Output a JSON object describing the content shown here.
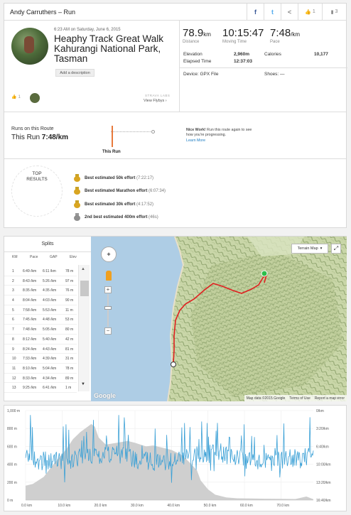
{
  "header": {
    "title": "Andy Carruthers – Run",
    "fb": "f",
    "tw": "t",
    "share": "<",
    "kudos_count": "1",
    "comments_count": "3"
  },
  "activity": {
    "date": "6:23 AM on Saturday, June 6, 2015",
    "name": "Heaphy Track Great Walk Kahurangi National Park, Tasman",
    "add_description": "Add a description",
    "kudos": "1",
    "strava_labs": "STRAVA LABS",
    "view_flybys": "View Flybys ›"
  },
  "stats": {
    "distance": {
      "value": "78.9",
      "unit": "km",
      "label": "Distance"
    },
    "moving_time": {
      "value": "10:15:47",
      "label": "Moving Time"
    },
    "pace": {
      "value": "7:48",
      "unit": "/km",
      "label": "Pace"
    },
    "elevation_label": "Elevation",
    "elevation_value": "2,960m",
    "calories_label": "Calories",
    "calories_value": "10,177",
    "elapsed_label": "Elapsed Time",
    "elapsed_value": "12:37:03",
    "device_label": "Device: GPX File",
    "shoes_label": "Shoes: —"
  },
  "route": {
    "runs_on_route": "Runs on this Route",
    "this_run_prefix": "This Run ",
    "this_run_pace": "7:48/km",
    "marker_label": "This Run",
    "nice_bold": "Nice Work!",
    "nice_text": " Run this route again to see how you're progressing.",
    "learn_more": "Learn More"
  },
  "top_results": {
    "title": "TOP RESULTS",
    "items": [
      {
        "medal": "gold",
        "text": "Best estimated 50k effort",
        "time": "(7:22:17)"
      },
      {
        "medal": "gold",
        "text": "Best estimated Marathon effort",
        "time": "(6:07:34)"
      },
      {
        "medal": "gold",
        "text": "Best estimated 30k effort",
        "time": "(4:17:52)"
      },
      {
        "medal": "silver",
        "text": "2nd best estimated 400m effort",
        "time": "(46s)"
      }
    ]
  },
  "splits": {
    "title": "Splits",
    "columns": [
      "KM",
      "Pace",
      "GAP",
      "Elev"
    ],
    "rows": [
      [
        "1",
        "6:49 /km",
        "6:11 /km",
        "78 m"
      ],
      [
        "2",
        "8:43 /km",
        "5:26 /km",
        "97 m"
      ],
      [
        "3",
        "8:35 /km",
        "4:35 /km",
        "76 m"
      ],
      [
        "4",
        "8:04 /km",
        "4:03 /km",
        "90 m"
      ],
      [
        "5",
        "7:58 /km",
        "5:53 /km",
        "11 m"
      ],
      [
        "6",
        "7:45 /km",
        "4:48 /km",
        "53 m"
      ],
      [
        "7",
        "7:48 /km",
        "5:05 /km",
        "80 m"
      ],
      [
        "8",
        "8:12 /km",
        "5:40 /km",
        "42 m"
      ],
      [
        "9",
        "8:24 /km",
        "4:43 /km",
        "81 m"
      ],
      [
        "10",
        "7:33 /km",
        "4:39 /km",
        "31 m"
      ],
      [
        "11",
        "8:10 /km",
        "5:04 /km",
        "78 m"
      ],
      [
        "12",
        "8:33 /km",
        "4:34 /km",
        "89 m"
      ],
      [
        "13",
        "9:25 /km",
        "6:41 /km",
        "1 m"
      ]
    ]
  },
  "map": {
    "map_type": "Terrain Map",
    "google": "Google",
    "attribution": "Map data ©2015 Google",
    "terms": "Terms of Use",
    "report": "Report a map error"
  },
  "elevation_chart": {
    "y_left": [
      "1,000 m",
      "800 m",
      "600 m",
      "400 m",
      "200 m",
      "0 m"
    ],
    "y_right": [
      "0/km",
      "3:20/km",
      "6:40/km",
      "10:00/km",
      "13:20/km",
      "16:40/km"
    ],
    "x": [
      "0.0 km",
      "10.0 km",
      "20.0 km",
      "30.0 km",
      "40.0 km",
      "50.0 km",
      "60.0 km",
      "70.0 km"
    ]
  }
}
